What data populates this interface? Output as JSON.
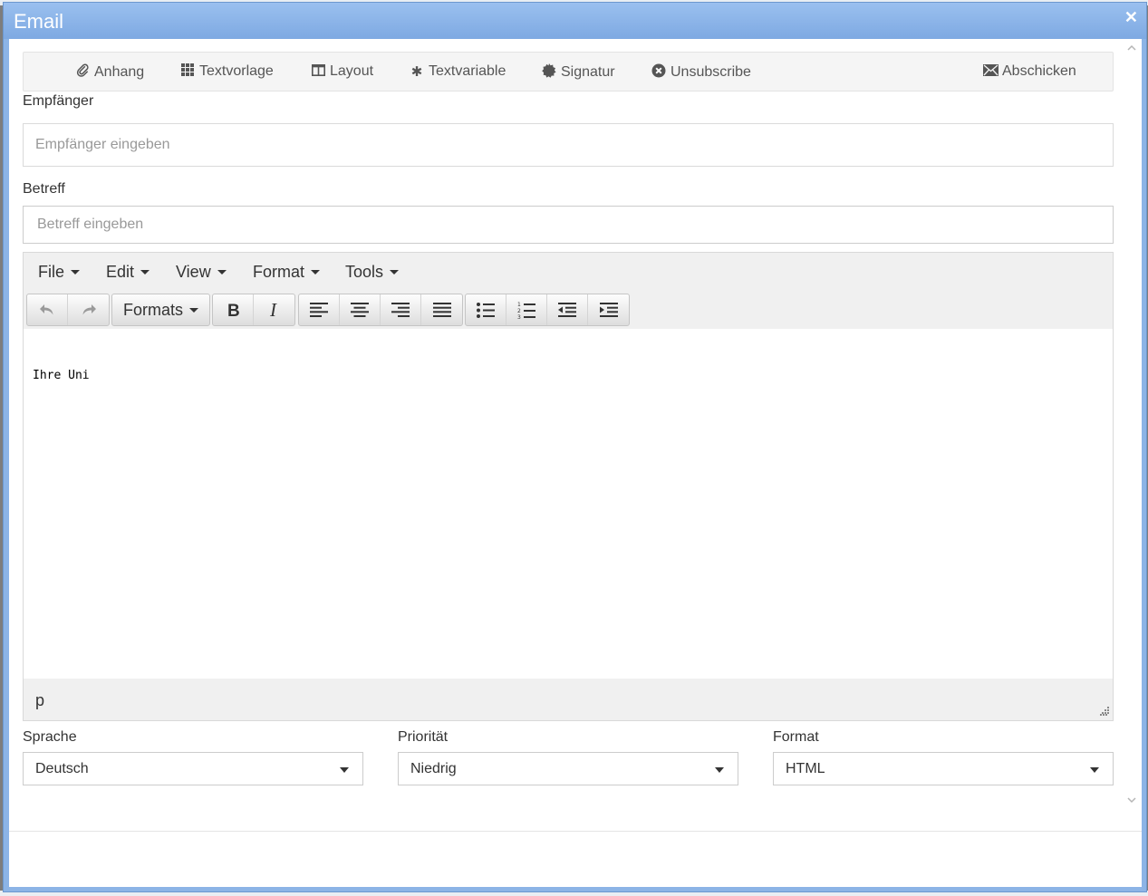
{
  "dialog": {
    "title": "Email",
    "close_glyph": "✕"
  },
  "toolbar": {
    "items": [
      {
        "label": "Anhang",
        "icon": "paperclip-icon"
      },
      {
        "label": "Textvorlage",
        "icon": "grid-icon"
      },
      {
        "label": "Layout",
        "icon": "columns-icon"
      },
      {
        "label": "Textvariable",
        "icon": "asterisk-icon"
      },
      {
        "label": "Signatur",
        "icon": "certificate-icon"
      },
      {
        "label": "Unsubscribe",
        "icon": "remove-circle-icon"
      }
    ],
    "send": {
      "label": "Abschicken",
      "icon": "envelope-icon"
    }
  },
  "recipient": {
    "label": "Empfänger",
    "placeholder": "Empfänger eingeben"
  },
  "subject": {
    "label": "Betreff",
    "placeholder": "Betreff eingeben"
  },
  "editor": {
    "menu": [
      "File",
      "Edit",
      "View",
      "Format",
      "Tools"
    ],
    "formats_label": "Formats",
    "body_text": "Ihre Uni",
    "path": "p"
  },
  "options": {
    "language": {
      "label": "Sprache",
      "value": "Deutsch"
    },
    "priority": {
      "label": "Priorität",
      "value": "Niedrig"
    },
    "format": {
      "label": "Format",
      "value": "HTML"
    }
  },
  "colors": {
    "titlebar": "#8cb4e6",
    "content_bg": "#ffffff",
    "toolbar_bg": "#f5f5f5"
  }
}
